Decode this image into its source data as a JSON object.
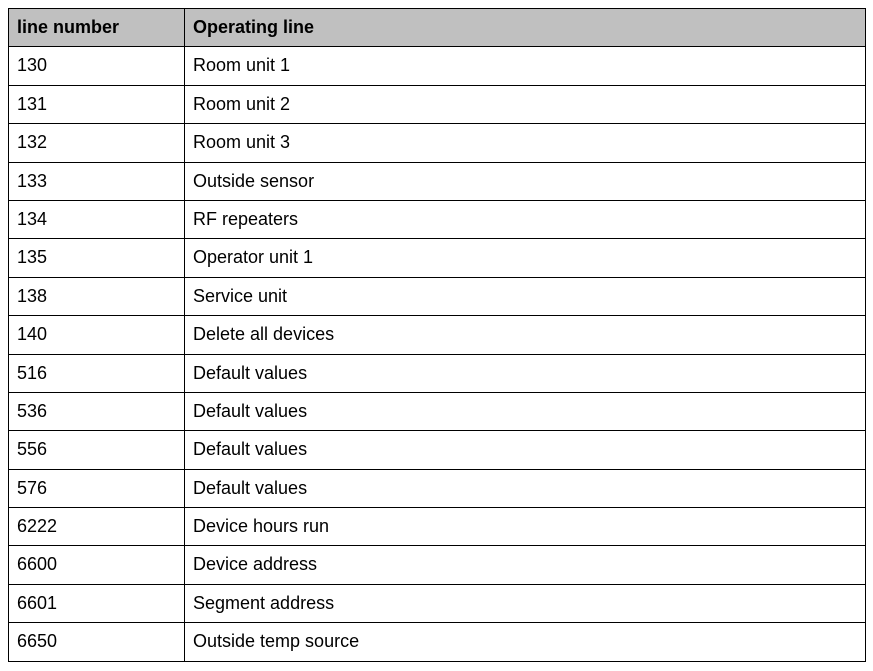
{
  "chart_data": {
    "type": "table",
    "headers": [
      "line number",
      "Operating line"
    ],
    "rows": [
      {
        "number": "130",
        "operating": "Room unit 1"
      },
      {
        "number": "131",
        "operating": "Room unit 2"
      },
      {
        "number": "132",
        "operating": "Room unit 3"
      },
      {
        "number": "133",
        "operating": "Outside sensor"
      },
      {
        "number": "134",
        "operating": "RF repeaters"
      },
      {
        "number": "135",
        "operating": "Operator unit 1"
      },
      {
        "number": "138",
        "operating": "Service unit"
      },
      {
        "number": "140",
        "operating": "Delete all devices"
      },
      {
        "number": "516",
        "operating": "Default values"
      },
      {
        "number": "536",
        "operating": "Default values"
      },
      {
        "number": "556",
        "operating": "Default values"
      },
      {
        "number": "576",
        "operating": "Default values"
      },
      {
        "number": "6222",
        "operating": "Device hours run"
      },
      {
        "number": "6600",
        "operating": "Device address"
      },
      {
        "number": "6601",
        "operating": "Segment address"
      },
      {
        "number": "6650",
        "operating": "Outside temp source"
      }
    ]
  }
}
